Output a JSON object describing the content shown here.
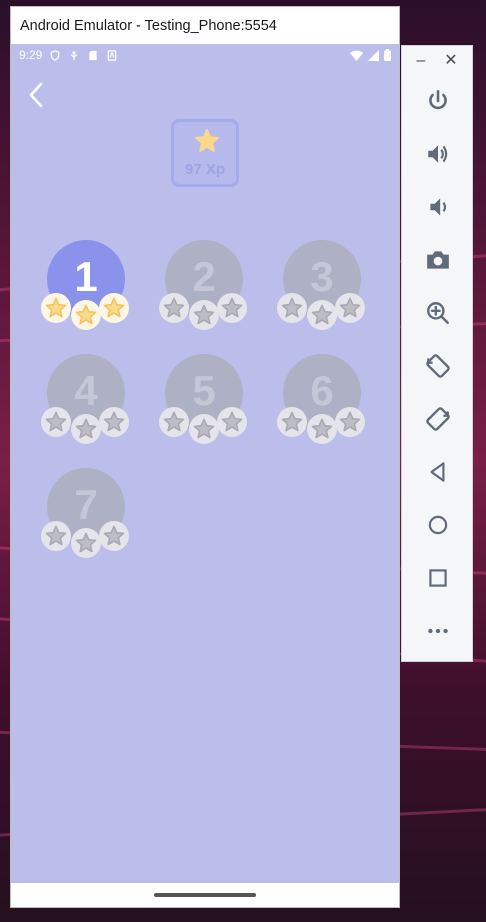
{
  "window": {
    "title": "Android Emulator - Testing_Phone:5554"
  },
  "status_bar": {
    "time": "9:29",
    "icons": [
      "shield-icon",
      "usb-icon",
      "sd-card-icon",
      "keyboard-icon",
      "wifi-icon",
      "signal-icon",
      "battery-icon"
    ]
  },
  "app": {
    "xp_label": "97 Xp",
    "levels": [
      {
        "number": "1",
        "stars_earned": 3,
        "locked": false
      },
      {
        "number": "2",
        "stars_earned": 0,
        "locked": true
      },
      {
        "number": "3",
        "stars_earned": 0,
        "locked": true
      },
      {
        "number": "4",
        "stars_earned": 0,
        "locked": true
      },
      {
        "number": "5",
        "stars_earned": 0,
        "locked": true
      },
      {
        "number": "6",
        "stars_earned": 0,
        "locked": true
      },
      {
        "number": "7",
        "stars_earned": 0,
        "locked": true
      }
    ]
  },
  "toolbar": {
    "buttons": [
      "power-icon",
      "volume-up-icon",
      "volume-down-icon",
      "camera-icon",
      "zoom-icon",
      "rotate-left-icon",
      "rotate-right-icon",
      "back-icon",
      "home-icon",
      "overview-icon",
      "more-icon"
    ]
  },
  "colors": {
    "screen_bg": "#bbbeea",
    "active_level": "#8b92ec",
    "locked_level": "#aeb0c4",
    "star_gold": "#fcd98a",
    "star_gray": "#bdbdc6"
  }
}
